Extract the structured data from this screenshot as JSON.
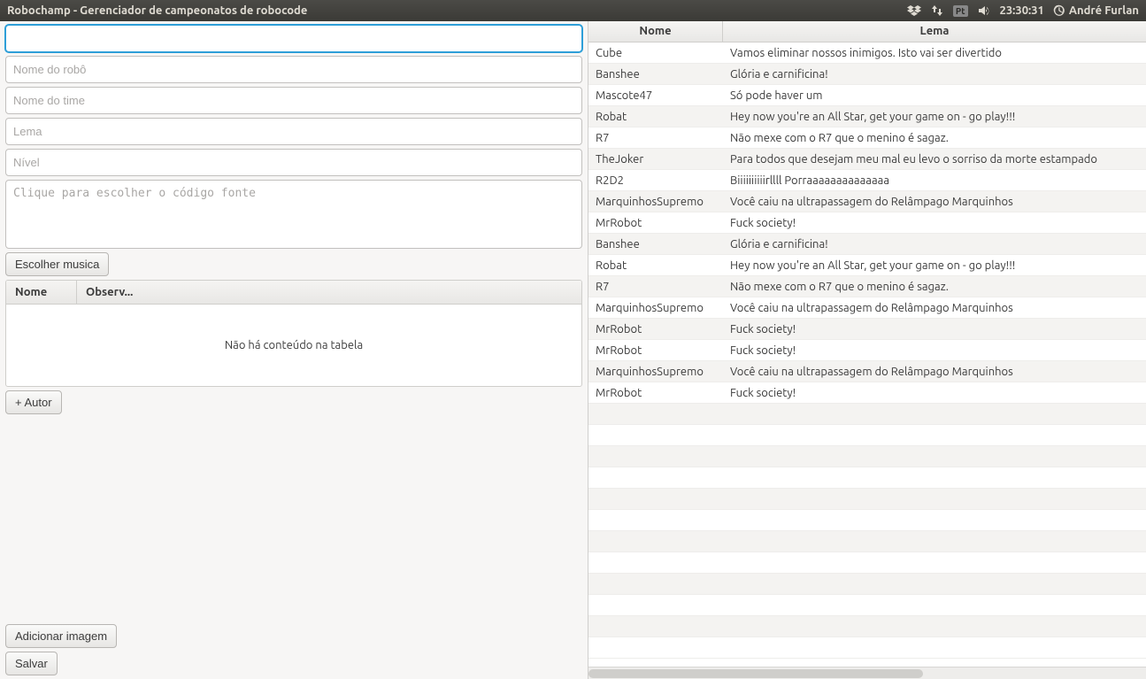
{
  "menubar": {
    "title": "Robochamp - Gerenciador de campeonatos de robocode",
    "lang": "Pt",
    "clock": "23:30:31",
    "user": "André Furlan"
  },
  "form": {
    "field0_placeholder": "",
    "robot_name_placeholder": "Nome do robô",
    "team_name_placeholder": "Nome do time",
    "lema_placeholder": "Lema",
    "nivel_placeholder": "Nível",
    "source_placeholder": "Clique para escolher o código fonte",
    "choose_music_label": "Escolher musica",
    "add_author_label": "+ Autor",
    "add_image_label": "Adicionar imagem",
    "save_label": "Salvar"
  },
  "authors_table": {
    "col_nome": "Nome",
    "col_observ": "Observ...",
    "empty_message": "Não há conteúdo na tabela"
  },
  "data_table": {
    "col_nome": "Nome",
    "col_lema": "Lema",
    "rows": [
      {
        "nome": "Cube",
        "lema": "Vamos eliminar nossos inimigos. Isto vai ser divertido"
      },
      {
        "nome": "Banshee",
        "lema": "Glória e carnificina!"
      },
      {
        "nome": "Mascote47",
        "lema": "Só pode haver um"
      },
      {
        "nome": "Robat",
        "lema": "Hey now you're an All Star, get your game on - go play!!!"
      },
      {
        "nome": "R7",
        "lema": "Não mexe com o R7 que o menino é sagaz."
      },
      {
        "nome": "TheJoker",
        "lema": "Para todos que desejam meu mal eu levo o sorriso da morte estampado"
      },
      {
        "nome": "R2D2",
        "lema": "Biiiiiiiiiirllll Porraaaaaaaaaaaaaa"
      },
      {
        "nome": "MarquinhosSupremo",
        "lema": "Você caiu na ultrapassagem do Relâmpago Marquinhos"
      },
      {
        "nome": "MrRobot",
        "lema": "Fuck society!"
      },
      {
        "nome": "Banshee",
        "lema": "Glória e carnificina!"
      },
      {
        "nome": "Robat",
        "lema": "Hey now you're an All Star, get your game on - go play!!!"
      },
      {
        "nome": "R7",
        "lema": "Não mexe com o R7 que o menino é sagaz."
      },
      {
        "nome": "MarquinhosSupremo",
        "lema": "Você caiu na ultrapassagem do Relâmpago Marquinhos"
      },
      {
        "nome": "MrRobot",
        "lema": "Fuck society!"
      },
      {
        "nome": "MrRobot",
        "lema": "Fuck society!"
      },
      {
        "nome": "MarquinhosSupremo",
        "lema": "Você caiu na ultrapassagem do Relâmpago Marquinhos"
      },
      {
        "nome": "MrRobot",
        "lema": "Fuck society!"
      }
    ],
    "extra_empty_rows": 12
  }
}
